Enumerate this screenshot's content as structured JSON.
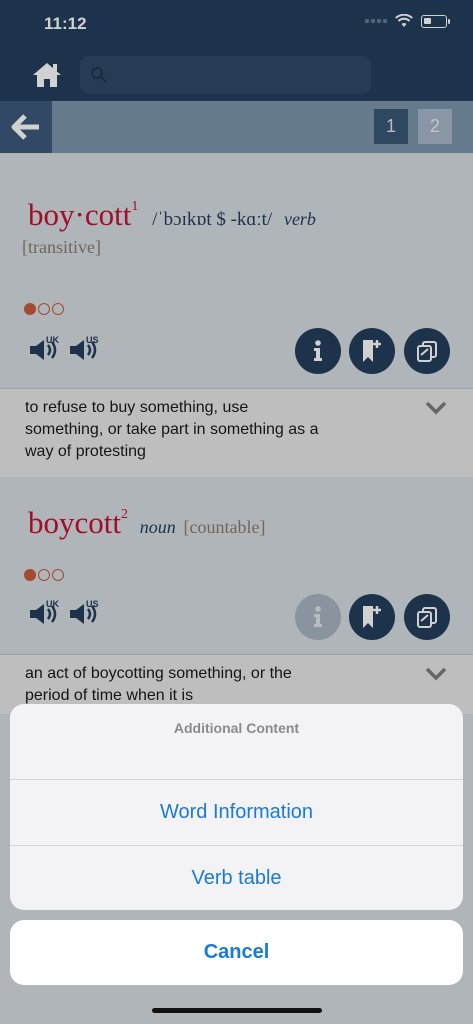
{
  "status_bar": {
    "time": "11:12"
  },
  "nav": {
    "page_1": "1",
    "page_2": "2"
  },
  "entry_1": {
    "headword": "boy·cott",
    "homograph": "1",
    "pronunciation": "/ˈbɔɪkɒt  $ -kɑːt/",
    "pos": "verb",
    "grammar": "[transitive]",
    "audio_uk": "UK",
    "audio_us": "US",
    "definition": "to refuse to buy something, use something, or take part in something as a way of protesting"
  },
  "entry_2": {
    "headword": "boycott",
    "homograph": "2",
    "pos": "noun",
    "grammar": "[countable]",
    "audio_uk": "UK",
    "audio_us": "US",
    "definition": "an act of boycotting something, or the period of time when it is"
  },
  "action_sheet": {
    "title": "Additional Content",
    "items": [
      "Word Information",
      "Verb table"
    ],
    "cancel": "Cancel"
  },
  "colors": {
    "header": "#243f5c",
    "headword": "#c8102e",
    "link": "#1a7ad8"
  }
}
